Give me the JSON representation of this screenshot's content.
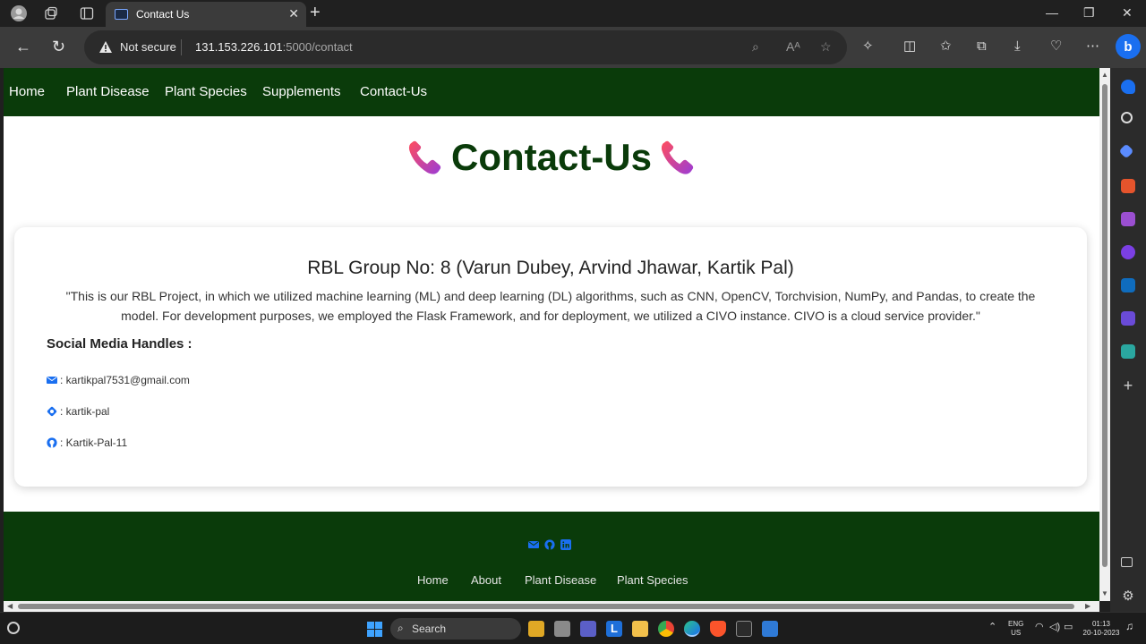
{
  "browser": {
    "tab_title": "Contact Us",
    "security_label": "Not secure",
    "url_host": "131.153.226.101",
    "url_rest": ":5000/contact"
  },
  "site": {
    "nav": [
      "Home",
      "Plant Disease",
      "Plant Species",
      "Supplements",
      "Contact-Us"
    ],
    "page_title": "Contact-Us",
    "card": {
      "heading": "RBL Group No: 8 (Varun Dubey, Arvind Jhawar, Kartik Pal)",
      "description": "\"This is our RBL Project, in which we utilized machine learning (ML) and deep learning (DL) algorithms, such as CNN, OpenCV, Torchvision, NumPy, and Pandas, to create the model. For development purposes, we employed the Flask Framework, and for deployment, we utilized a CIVO instance. CIVO is a cloud service provider.\"",
      "social_heading": "Social Media Handles :",
      "social": [
        {
          "icon": "envelope-icon",
          "text": ": kartikpal7531@gmail.com"
        },
        {
          "icon": "hashnode-icon",
          "text": ": kartik-pal"
        },
        {
          "icon": "github-icon",
          "text": ": Kartik-Pal-11"
        }
      ]
    },
    "footer_links": [
      "Home",
      "About",
      "Plant Disease",
      "Plant Species"
    ]
  },
  "taskbar": {
    "search_label": "Search",
    "lang_top": "ENG",
    "lang_bottom": "US",
    "time": "01:13",
    "date": "20-10-2023"
  },
  "colors": {
    "nav_green": "#0a3b0a",
    "accent_blue": "#1a6ff0"
  }
}
